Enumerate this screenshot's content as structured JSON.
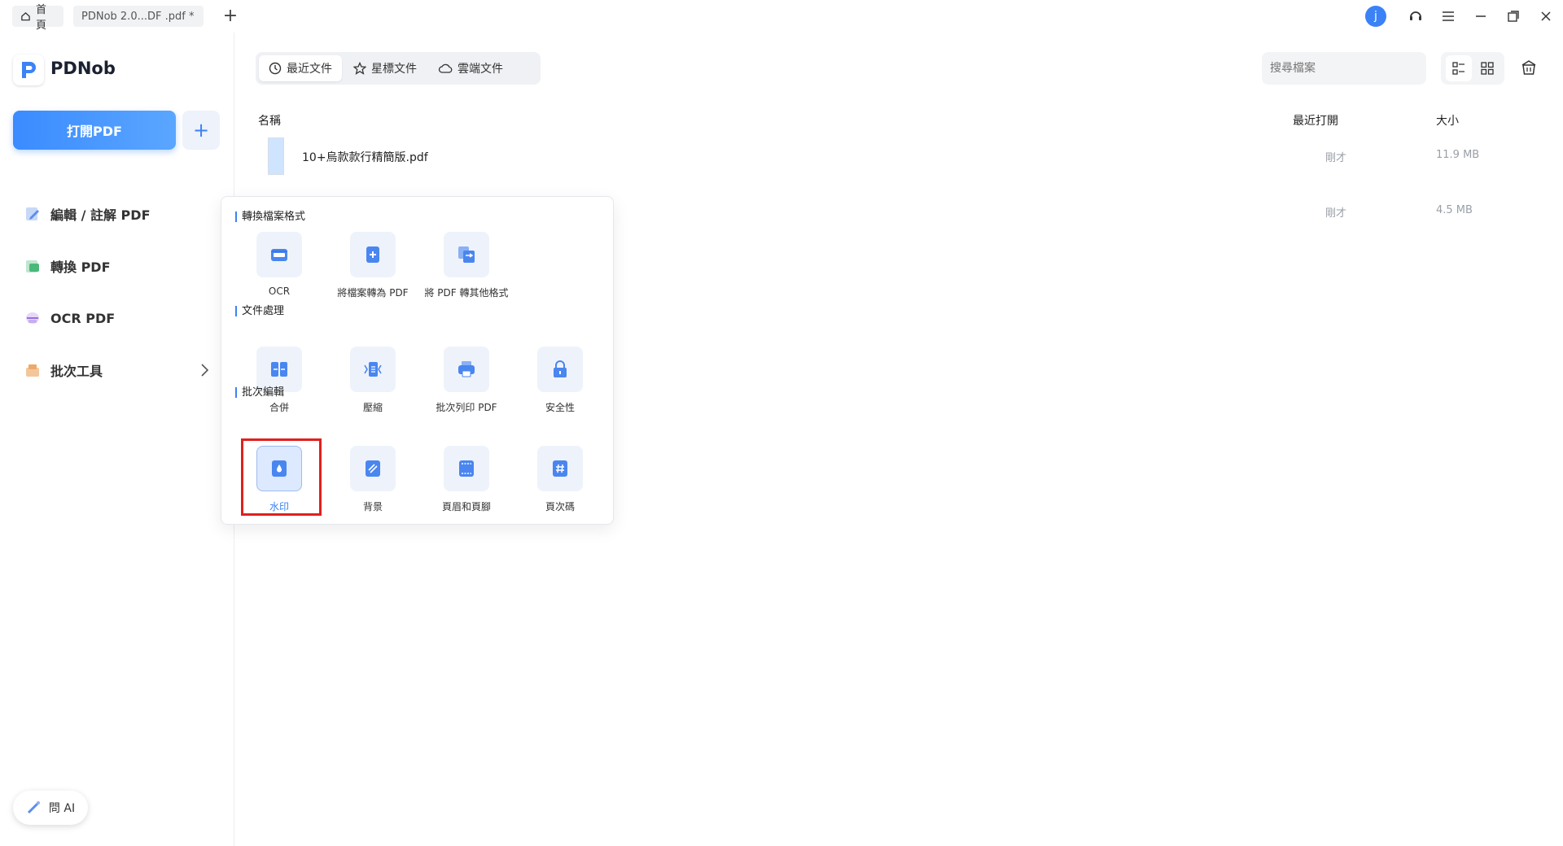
{
  "titlebar": {
    "tabs": [
      {
        "label": "首頁",
        "icon": "home-icon"
      },
      {
        "label": "PDNob 2.0...DF .pdf *"
      }
    ],
    "new_tab_label": "+",
    "avatar_letter": "j"
  },
  "sidebar": {
    "brand": "PDNob",
    "open_pdf_label": "打開PDF",
    "add_label": "+",
    "items": [
      {
        "label": "編輯 / 註解 PDF",
        "icon": "edit-icon"
      },
      {
        "label": "轉換 PDF",
        "icon": "convert-icon"
      },
      {
        "label": "OCR PDF",
        "icon": "ocr-icon"
      },
      {
        "label": "批次工具",
        "icon": "batch-icon"
      }
    ],
    "ask_ai_label": "問 AI"
  },
  "main": {
    "tabs": [
      {
        "label": "最近文件",
        "icon": "clock-icon"
      },
      {
        "label": "星標文件",
        "icon": "star-icon"
      },
      {
        "label": "雲端文件",
        "icon": "cloud-icon"
      }
    ],
    "search": {
      "placeholder": "搜尋檔案"
    },
    "columns": {
      "name": "名稱",
      "opened": "最近打開",
      "size": "大小"
    },
    "files": [
      {
        "name": "10+烏款款行精簡版.pdf",
        "opened": "剛才",
        "size": "11.9 MB"
      },
      {
        "name": "",
        "opened": "剛才",
        "size": "4.5 MB"
      }
    ]
  },
  "panel": {
    "sections": [
      {
        "title": "轉換檔案格式",
        "tools": [
          {
            "label": "OCR",
            "icon": "ocr-tool-icon"
          },
          {
            "label": "將檔案轉為 PDF",
            "icon": "to-pdf-icon"
          },
          {
            "label": "將 PDF 轉其他格式",
            "icon": "from-pdf-icon"
          }
        ]
      },
      {
        "title": "文件處理",
        "tools": [
          {
            "label": "合併",
            "icon": "merge-icon"
          },
          {
            "label": "壓縮",
            "icon": "compress-icon"
          },
          {
            "label": "批次列印 PDF",
            "icon": "print-icon"
          },
          {
            "label": "安全性",
            "icon": "lock-icon"
          }
        ]
      },
      {
        "title": "批次編輯",
        "tools": [
          {
            "label": "水印",
            "icon": "watermark-icon"
          },
          {
            "label": "背景",
            "icon": "background-icon"
          },
          {
            "label": "頁眉和頁腳",
            "icon": "header-footer-icon"
          },
          {
            "label": "頁次碼",
            "icon": "page-number-icon"
          }
        ]
      }
    ]
  },
  "colors": {
    "accent": "#3b82f6",
    "highlight": "#e0201e"
  }
}
